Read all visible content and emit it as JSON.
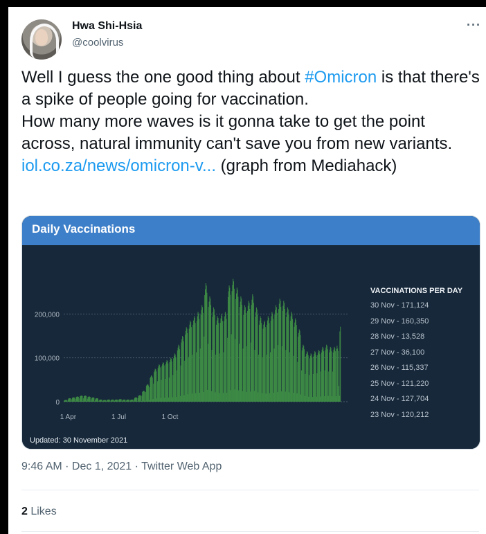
{
  "user": {
    "name": "Hwa Shi-Hsia",
    "handle": "@coolvirus"
  },
  "more_icon": "ellipsis-icon",
  "tweet": {
    "line1_before": "Well I guess the one good thing about ",
    "hashtag": "#Omicron",
    "line1_after": " is that there's a spike of people going for vaccination.",
    "line2": "How many more waves is it gonna take to get the point across, natural immunity can't save you from new variants.",
    "link": "iol.co.za/news/omicron-v...",
    "link_after": " (graph from Mediahack)"
  },
  "card": {
    "title": "Daily Vaccinations",
    "updated": "Updated: 30 November 2021",
    "legend_title": "VACCINATIONS PER DAY",
    "legend_items": [
      "30 Nov - 171,124",
      "29 Nov - 160,350",
      "28 Nov - 13,528",
      "27 Nov - 36,100",
      "26 Nov - 115,337",
      "25 Nov - 121,220",
      "24 Nov - 127,704",
      "23 Nov - 120,212"
    ],
    "colors": {
      "header": "#3e7fc9",
      "bars": "#3d8a45",
      "background": "#17283a"
    }
  },
  "chart_data": {
    "type": "bar",
    "title": "Daily Vaccinations",
    "x_ticks": [
      "1 Apr",
      "1 Jul",
      "1 Oct"
    ],
    "y_ticks": [
      "0",
      "100,000",
      "200,000"
    ],
    "ylim": [
      0,
      300000
    ],
    "grid": true,
    "legend_placement": "right",
    "weekly_pattern": [
      0.55,
      0.9,
      0.95,
      1.0,
      0.98,
      0.92,
      0.1
    ],
    "weekly_levels": [
      4000,
      8000,
      10000,
      12000,
      14000,
      14000,
      12000,
      10000,
      8000,
      5000,
      4000,
      5000,
      5000,
      5000,
      6000,
      5000,
      5000,
      5000,
      10000,
      15000,
      25000,
      40000,
      60000,
      75000,
      85000,
      90000,
      95000,
      100000,
      110000,
      130000,
      150000,
      170000,
      185000,
      195000,
      205000,
      220000,
      270000,
      240000,
      215000,
      195000,
      200000,
      205000,
      265000,
      280000,
      260000,
      240000,
      220000,
      230000,
      245000,
      215000,
      195000,
      185000,
      195000,
      205000,
      220000,
      235000,
      230000,
      215000,
      205000,
      190000,
      165000,
      130000,
      115000,
      110000,
      115000,
      118000,
      125000,
      130000,
      125000,
      125000
    ],
    "last_days": [
      120212,
      127704,
      121220,
      115337,
      36100,
      13528,
      160350,
      171124
    ]
  },
  "footer": {
    "timestamp": "9:46 AM · Dec 1, 2021 · Twitter Web App",
    "likes_count": "2",
    "likes_label": " Likes"
  }
}
